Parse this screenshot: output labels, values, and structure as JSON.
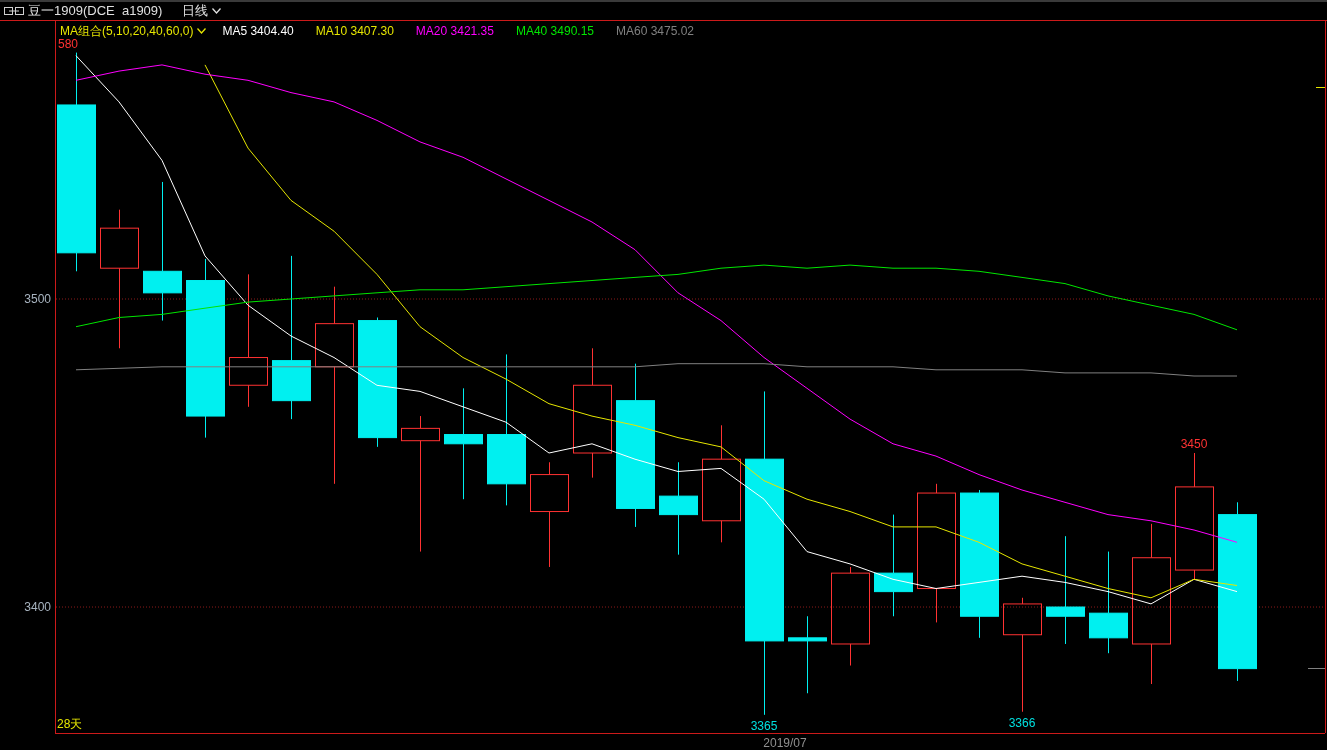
{
  "header": {
    "title": "豆一1909(DCE  a1909)",
    "period": "日线"
  },
  "legend": {
    "label": "MA组合(5,10,20,40,60,0)",
    "items": [
      {
        "value": "3404.40"
      },
      {
        "value": "3407.30"
      },
      {
        "value": "3421.35"
      },
      {
        "value": "3490.15"
      },
      {
        "value": "3475.02"
      }
    ]
  },
  "chart_data": {
    "type": "line",
    "xlabel": "2019/07",
    "ylim": [
      3359,
      3590
    ],
    "yticks": [
      3400,
      3500
    ],
    "series": [
      {
        "name": "MA5",
        "color": "#ffffff",
        "values": [
          3579,
          3564,
          3545,
          3514,
          3498,
          3488,
          3481,
          3472,
          3470,
          3465,
          3460,
          3450,
          3453,
          3448,
          3444,
          3445,
          3435,
          3418,
          3414,
          3409,
          3406,
          3408,
          3410,
          3408,
          3405,
          3401,
          3409,
          3405
        ]
      },
      {
        "name": "MA10",
        "color": "#e6e600",
        "values": [
          null,
          null,
          null,
          3576,
          3549,
          3532,
          3522,
          3508,
          3491,
          3481,
          3474,
          3466,
          3462,
          3459,
          3455,
          3452,
          3441,
          3435,
          3431,
          3426,
          3426,
          3421,
          3414,
          3410,
          3406,
          3403,
          3409,
          3407
        ]
      },
      {
        "name": "MA20",
        "color": "#ff00ff",
        "values": [
          3571,
          3574,
          3576,
          3573,
          3571,
          3567,
          3564,
          3558,
          3551,
          3546,
          3539,
          3532,
          3525,
          3516,
          3502,
          3493,
          3481,
          3471,
          3461,
          3453,
          3449,
          3443,
          3438,
          3434,
          3430,
          3428,
          3425,
          3421
        ]
      },
      {
        "name": "MA40",
        "color": "#00e600",
        "values": [
          3491,
          3494,
          3495,
          3497,
          3499,
          3500,
          3501,
          3502,
          3503,
          3503,
          3504,
          3505,
          3506,
          3507,
          3508,
          3510,
          3511,
          3510,
          3511,
          3510,
          3510,
          3509,
          3507,
          3505,
          3501,
          3498,
          3495,
          3490
        ]
      },
      {
        "name": "MA60",
        "color": "#808080",
        "values": [
          3477,
          3477.5,
          3478,
          3478,
          3478,
          3478,
          3478,
          3478,
          3478,
          3478,
          3478,
          3478,
          3478,
          3478,
          3479,
          3479,
          3479,
          3478,
          3478,
          3478,
          3477,
          3477,
          3477,
          3476,
          3476,
          3476,
          3475,
          3475
        ]
      }
    ],
    "annotations": [
      "580",
      "3365",
      "3366",
      "3450"
    ]
  },
  "day_count": "28天"
}
